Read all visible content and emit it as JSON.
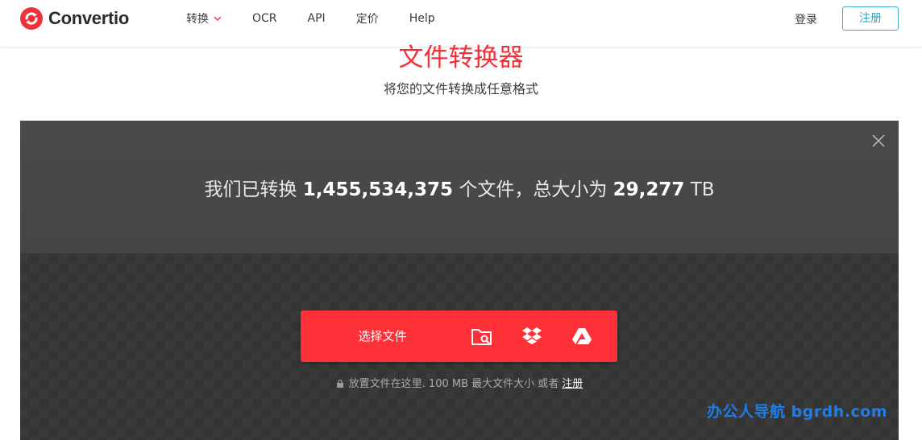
{
  "brand": {
    "name": "Convertio",
    "accent": "#f0313a"
  },
  "nav": {
    "items": [
      {
        "label": "转换",
        "has_dropdown": true
      },
      {
        "label": "OCR"
      },
      {
        "label": "API"
      },
      {
        "label": "定价"
      },
      {
        "label": "Help"
      }
    ],
    "login_label": "登录",
    "signup_label": "注册"
  },
  "hero": {
    "title": "文件转换器",
    "subtitle": "将您的文件转换成任意格式"
  },
  "stats": {
    "prefix": "我们已转换",
    "files_count": "1,455,534,375",
    "middle": "个文件，总大小为",
    "total_size": "29,277",
    "unit": "TB"
  },
  "upload": {
    "choose_label": "选择文件",
    "icons": [
      "folder-search-icon",
      "dropbox-icon",
      "google-drive-icon"
    ],
    "hint_text": "放置文件在这里. 100 MB 最大文件大小 或者",
    "hint_link": "注册"
  },
  "watermark": "办公人导航  bgrdh.com"
}
